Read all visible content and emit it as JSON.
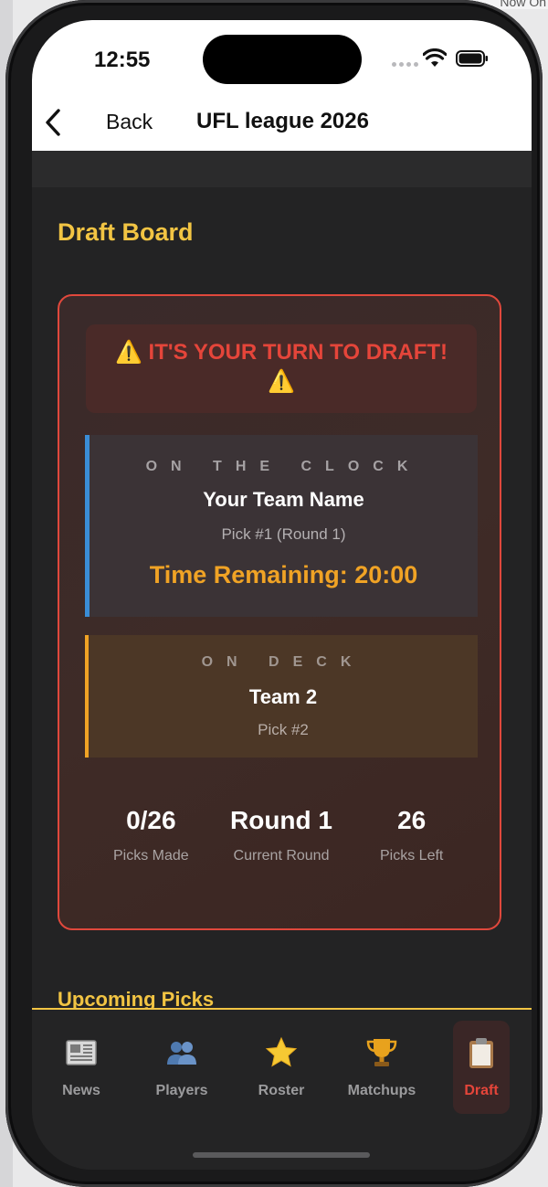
{
  "status_bar": {
    "time": "12:55"
  },
  "nav": {
    "back_label": "Back",
    "title": "UFL league 2026"
  },
  "peek_text": "Now On",
  "draft_board": {
    "section_title": "Draft Board",
    "alert": "⚠️ IT'S YOUR TURN TO DRAFT! ⚠️",
    "on_the_clock": {
      "label": "ON THE CLOCK",
      "team": "Your Team Name",
      "pick": "Pick #1 (Round 1)",
      "timer": "Time Remaining: 20:00"
    },
    "on_deck": {
      "label": "ON DECK",
      "team": "Team 2",
      "pick": "Pick #2"
    },
    "stats": [
      {
        "value": "0/26",
        "label": "Picks Made"
      },
      {
        "value": "Round 1",
        "label": "Current Round"
      },
      {
        "value": "26",
        "label": "Picks Left"
      }
    ]
  },
  "upcoming": {
    "title": "Upcoming Picks"
  },
  "tabs": [
    {
      "label": "News",
      "icon": "newspaper-icon"
    },
    {
      "label": "Players",
      "icon": "players-icon"
    },
    {
      "label": "Roster",
      "icon": "star-icon"
    },
    {
      "label": "Matchups",
      "icon": "trophy-icon"
    },
    {
      "label": "Draft",
      "icon": "clipboard-icon",
      "active": true
    }
  ],
  "colors": {
    "accent_yellow": "#f2c443",
    "alert_red": "#e5453a",
    "timer_orange": "#f0a325",
    "clock_blue": "#3a8dd6"
  }
}
